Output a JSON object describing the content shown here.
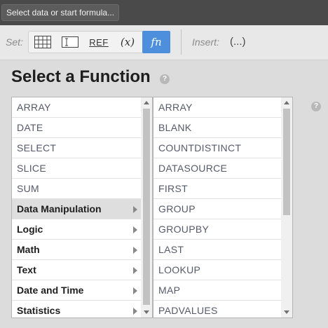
{
  "formula_bar": {
    "placeholder": "Select data or start formula..."
  },
  "toolbar": {
    "set_label": "Set:",
    "ref_label": "REF",
    "variable_label": "(x)",
    "function_label": "fn",
    "insert_label": "Insert:",
    "insert_value": "(...)",
    "active_color": "#4e8fdd"
  },
  "dialog": {
    "title": "Select a Function",
    "help_glyph": "?"
  },
  "left_list": {
    "items": [
      {
        "label": "ARRAY",
        "category": false,
        "selected": false
      },
      {
        "label": "DATE",
        "category": false,
        "selected": false
      },
      {
        "label": "SELECT",
        "category": false,
        "selected": false
      },
      {
        "label": "SLICE",
        "category": false,
        "selected": false
      },
      {
        "label": "SUM",
        "category": false,
        "selected": false
      },
      {
        "label": "Data Manipulation",
        "category": true,
        "selected": true
      },
      {
        "label": "Logic",
        "category": true,
        "selected": false
      },
      {
        "label": "Math",
        "category": true,
        "selected": false
      },
      {
        "label": "Text",
        "category": true,
        "selected": false
      },
      {
        "label": "Date and Time",
        "category": true,
        "selected": false
      },
      {
        "label": "Statistics",
        "category": true,
        "selected": false
      }
    ]
  },
  "right_list": {
    "items": [
      "ARRAY",
      "BLANK",
      "COUNTDISTINCT",
      "DATASOURCE",
      "FIRST",
      "GROUP",
      "GROUPBY",
      "LAST",
      "LOOKUP",
      "MAP",
      "PADVALUES"
    ]
  }
}
